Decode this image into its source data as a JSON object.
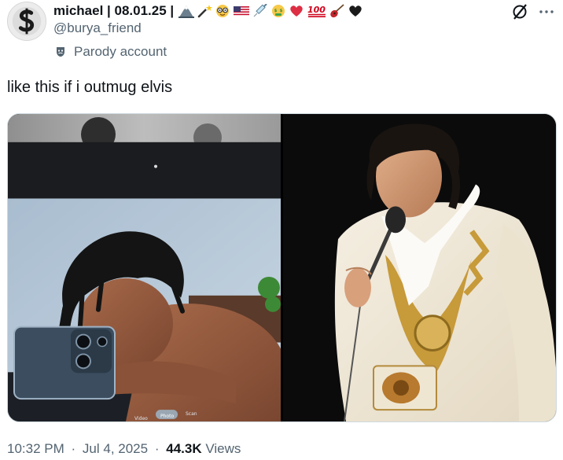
{
  "author": {
    "display_name": "michael | 08.01.25 |",
    "handle": "@burya_friend",
    "badge_label": "Parody account",
    "name_emojis": [
      "mountain-emoji",
      "magic-wand-emoji",
      "nerd-face-emoji",
      "us-flag-emoji",
      "syringe-emoji",
      "money-mouth-face-emoji",
      "red-heart-emoji",
      "hundred-points-emoji",
      "guitar-emoji",
      "black-heart-emoji"
    ]
  },
  "tweet": {
    "text": "like this if i outmug elvis"
  },
  "media": {
    "count": 2,
    "left_photo": {
      "camera_modes": [
        "Video",
        "Photo",
        "Scan"
      ]
    }
  },
  "meta": {
    "time": "10:32 PM",
    "date": "Jul 4, 2025",
    "views_count": "44.3K",
    "views_label": "Views",
    "separator": "·"
  },
  "icons": {
    "grok": "grok-icon",
    "more": "more-icon",
    "parody": "theater-masks-icon"
  },
  "colors": {
    "text_primary": "#0f1419",
    "text_secondary": "#536471",
    "border": "#cfd9de"
  }
}
